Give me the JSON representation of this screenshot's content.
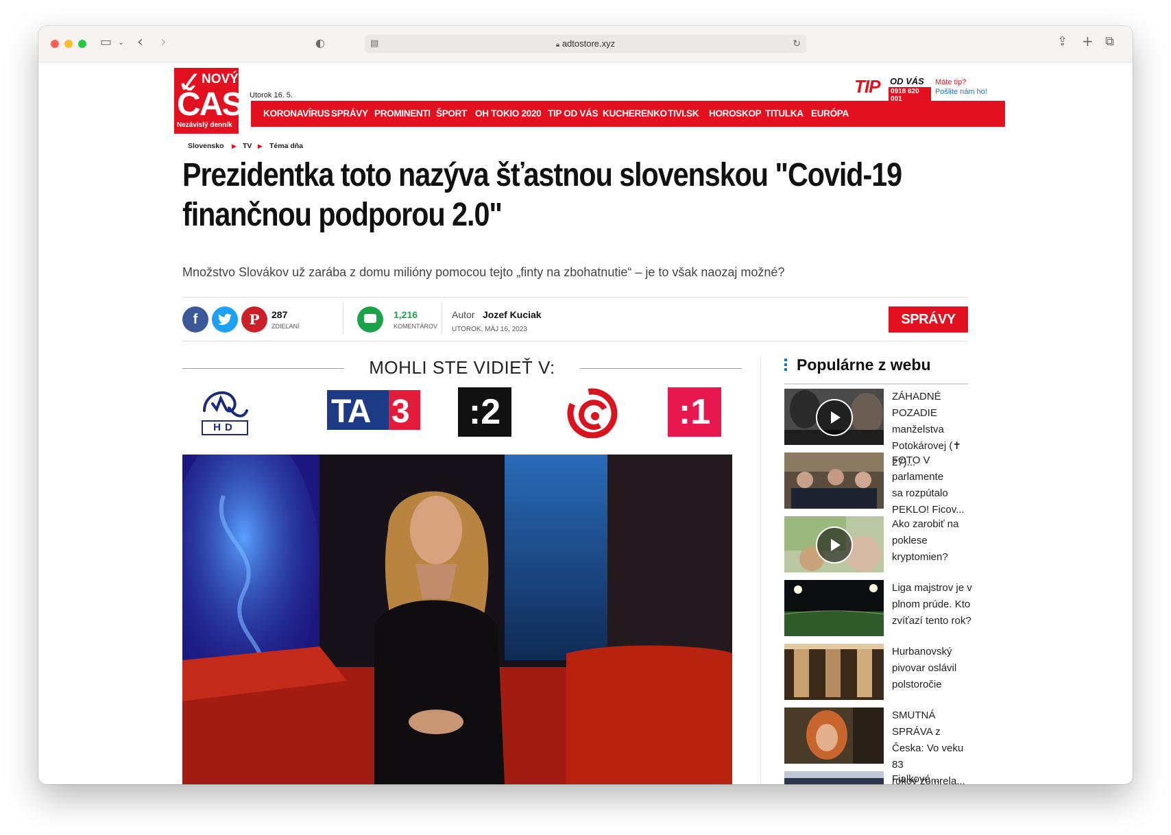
{
  "browser": {
    "url": "adtostore.xyz"
  },
  "header": {
    "logo": {
      "top": "NOVÝ",
      "main": "ČAS",
      "tagline": "Nezávislý denník"
    },
    "date": "Utorok 16. 5.",
    "tip": {
      "brand": "TIP",
      "brand2": "OD VÁS",
      "phone": "0918 620 001",
      "line1": "Máte tip?",
      "line2": "Pošlite nám ho!"
    }
  },
  "nav": [
    "KORONAVÍRUS",
    "SPRÁVY",
    "PROMINENTI",
    "ŠPORT",
    "OH TOKIO 2020",
    "TIP OD VÁS",
    "KUCHERENKO",
    "TIVI.SK",
    "HOROSKOP",
    "TITULKA",
    "EURÓPA"
  ],
  "breadcrumb": [
    "Slovensko",
    "TV",
    "Téma dňa"
  ],
  "article": {
    "headline_line1": "Prezidentka toto nazýva šťastnou slovenskou \"Covid-19",
    "headline_line2": "finančnou podporou 2.0\"",
    "lead": "Množstvo Slovákov už zarába z domu milióny pomocou tejto „finty na zbohatnutie“ – je to však naozaj možné?",
    "shares": "287",
    "shares_label": "ZDIEĽANÍ",
    "comments": "1,216",
    "comments_label": "KOMENTÁROV",
    "author_label": "Autor",
    "author": "Jozef Kuciak",
    "date": "UTOROK, MÁJ 16, 2023",
    "section_button": "SPRÁVY"
  },
  "tv": {
    "title": "MOHLI STE VIDIEŤ V:",
    "logos": {
      "hd": "HD",
      "ta3": "TA",
      "ta3_num": "3",
      "jojplus": ":2",
      "stv1": ":1"
    }
  },
  "sidebar": {
    "title": "Populárne z webu",
    "items": [
      {
        "line1": "ZÁHADNÉ POZADIE",
        "line2": "manželstva",
        "line3": "Potokárovej (✝ 27)..."
      },
      {
        "line1": "FOTO V parlamente",
        "line2": "sa rozpútalo",
        "line3": "PEKLO! Ficov..."
      },
      {
        "line1": "Ako zarobiť na",
        "line2": "poklese",
        "line3": "kryptomien?"
      },
      {
        "line1": "Liga majstrov je v",
        "line2": "plnom prúde. Kto",
        "line3": "zvíťazí tento rok?"
      },
      {
        "line1": "Hurbanovský",
        "line2": "pivovar oslávil",
        "line3": "polstoročie"
      },
      {
        "line1": "SMUTNÁ SPRÁVA z",
        "line2": "Česka: Vo veku 83",
        "line3": "rokov zomrela..."
      },
      {
        "line1": "Fialkové ...",
        "line2": "",
        "line3": ""
      }
    ]
  },
  "colors": {
    "brand_red": "#e3101f",
    "facebook": "#3b5998",
    "twitter": "#1da1f2",
    "pinterest": "#cb2027",
    "comments": "#1ca34a"
  }
}
